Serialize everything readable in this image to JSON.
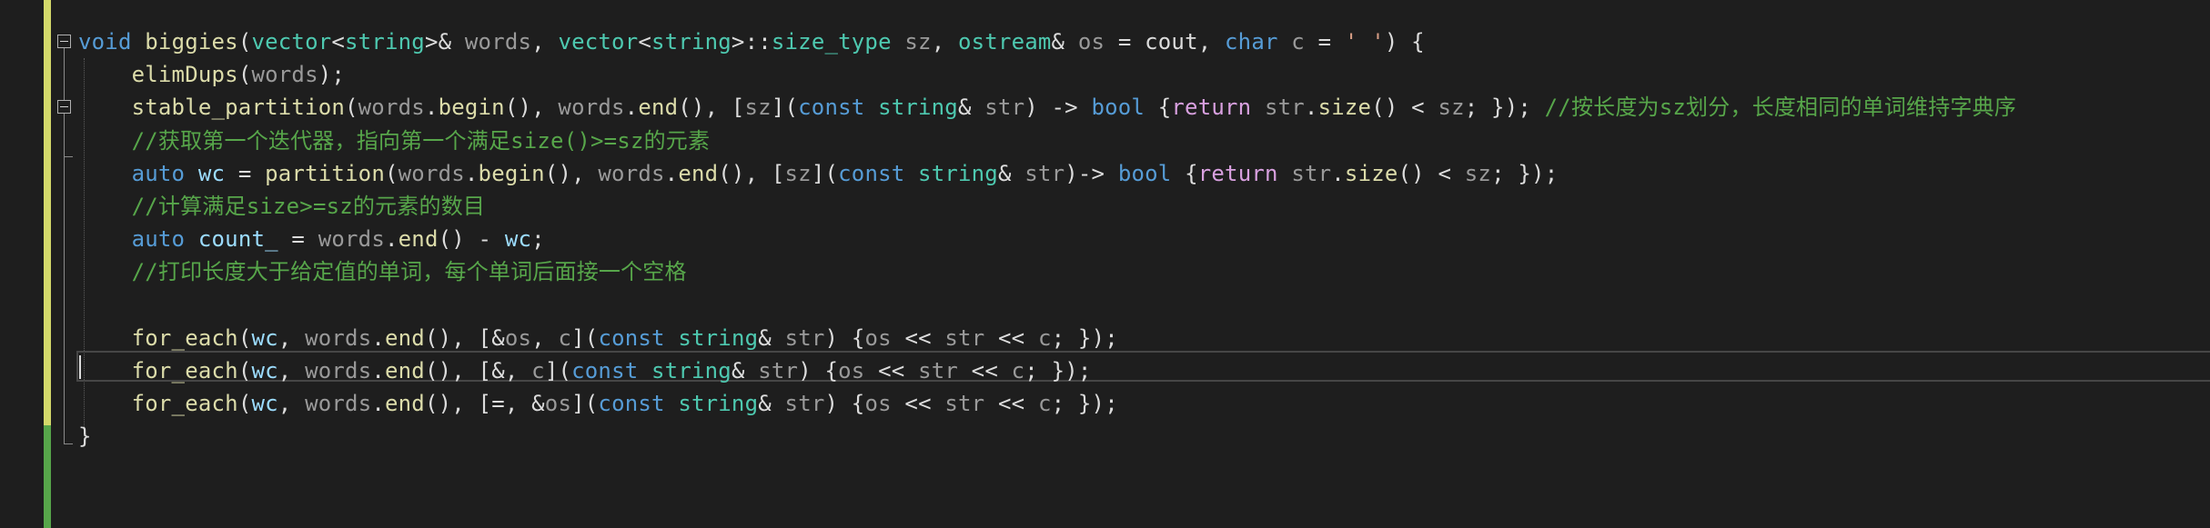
{
  "editor": {
    "lines": [
      [
        {
          "t": "void",
          "c": "kw"
        },
        {
          "t": " ",
          "c": "pl"
        },
        {
          "t": "biggies",
          "c": "fn"
        },
        {
          "t": "(",
          "c": "pl"
        },
        {
          "t": "vector",
          "c": "ty"
        },
        {
          "t": "<",
          "c": "pl"
        },
        {
          "t": "string",
          "c": "ty"
        },
        {
          "t": ">& ",
          "c": "pl"
        },
        {
          "t": "words",
          "c": "pm"
        },
        {
          "t": ", ",
          "c": "pl"
        },
        {
          "t": "vector",
          "c": "ty"
        },
        {
          "t": "<",
          "c": "pl"
        },
        {
          "t": "string",
          "c": "ty"
        },
        {
          "t": ">::",
          "c": "pl"
        },
        {
          "t": "size_type",
          "c": "ty"
        },
        {
          "t": " ",
          "c": "pl"
        },
        {
          "t": "sz",
          "c": "pm"
        },
        {
          "t": ", ",
          "c": "pl"
        },
        {
          "t": "ostream",
          "c": "ty"
        },
        {
          "t": "& ",
          "c": "pl"
        },
        {
          "t": "os",
          "c": "pm"
        },
        {
          "t": " = cout, ",
          "c": "pl"
        },
        {
          "t": "char",
          "c": "kw"
        },
        {
          "t": " ",
          "c": "pl"
        },
        {
          "t": "c",
          "c": "pm"
        },
        {
          "t": " = ",
          "c": "pl"
        },
        {
          "t": "' '",
          "c": "st"
        },
        {
          "t": ") {",
          "c": "pl"
        }
      ],
      [
        {
          "t": "    ",
          "c": "pl"
        },
        {
          "t": "elimDups",
          "c": "fn"
        },
        {
          "t": "(",
          "c": "pl"
        },
        {
          "t": "words",
          "c": "pm"
        },
        {
          "t": ");",
          "c": "pl"
        }
      ],
      [
        {
          "t": "    ",
          "c": "pl"
        },
        {
          "t": "stable_partition",
          "c": "fn"
        },
        {
          "t": "(",
          "c": "pl"
        },
        {
          "t": "words",
          "c": "pm"
        },
        {
          "t": ".",
          "c": "pl"
        },
        {
          "t": "begin",
          "c": "fn"
        },
        {
          "t": "(), ",
          "c": "pl"
        },
        {
          "t": "words",
          "c": "pm"
        },
        {
          "t": ".",
          "c": "pl"
        },
        {
          "t": "end",
          "c": "fn"
        },
        {
          "t": "(), [",
          "c": "pl"
        },
        {
          "t": "sz",
          "c": "pm"
        },
        {
          "t": "](",
          "c": "pl"
        },
        {
          "t": "const",
          "c": "kw"
        },
        {
          "t": " ",
          "c": "pl"
        },
        {
          "t": "string",
          "c": "ty"
        },
        {
          "t": "& ",
          "c": "pl"
        },
        {
          "t": "str",
          "c": "pm"
        },
        {
          "t": ") -> ",
          "c": "pl"
        },
        {
          "t": "bool",
          "c": "kw"
        },
        {
          "t": " {",
          "c": "pl"
        },
        {
          "t": "return",
          "c": "kw2"
        },
        {
          "t": " ",
          "c": "pl"
        },
        {
          "t": "str",
          "c": "pm"
        },
        {
          "t": ".",
          "c": "pl"
        },
        {
          "t": "size",
          "c": "fn"
        },
        {
          "t": "() < ",
          "c": "pl"
        },
        {
          "t": "sz",
          "c": "pm"
        },
        {
          "t": "; }); ",
          "c": "pl"
        },
        {
          "t": "//按长度为sz划分，长度相同的单词维持字典序",
          "c": "cm"
        }
      ],
      [
        {
          "t": "    ",
          "c": "pl"
        },
        {
          "t": "//获取第一个迭代器，指向第一个满足size()>=sz的元素",
          "c": "cm"
        }
      ],
      [
        {
          "t": "    ",
          "c": "pl"
        },
        {
          "t": "auto",
          "c": "kw"
        },
        {
          "t": " ",
          "c": "pl"
        },
        {
          "t": "wc",
          "c": "lv"
        },
        {
          "t": " = ",
          "c": "pl"
        },
        {
          "t": "partition",
          "c": "fn"
        },
        {
          "t": "(",
          "c": "pl"
        },
        {
          "t": "words",
          "c": "pm"
        },
        {
          "t": ".",
          "c": "pl"
        },
        {
          "t": "begin",
          "c": "fn"
        },
        {
          "t": "(), ",
          "c": "pl"
        },
        {
          "t": "words",
          "c": "pm"
        },
        {
          "t": ".",
          "c": "pl"
        },
        {
          "t": "end",
          "c": "fn"
        },
        {
          "t": "(), [",
          "c": "pl"
        },
        {
          "t": "sz",
          "c": "pm"
        },
        {
          "t": "](",
          "c": "pl"
        },
        {
          "t": "const",
          "c": "kw"
        },
        {
          "t": " ",
          "c": "pl"
        },
        {
          "t": "string",
          "c": "ty"
        },
        {
          "t": "& ",
          "c": "pl"
        },
        {
          "t": "str",
          "c": "pm"
        },
        {
          "t": ")-> ",
          "c": "pl"
        },
        {
          "t": "bool",
          "c": "kw"
        },
        {
          "t": " {",
          "c": "pl"
        },
        {
          "t": "return",
          "c": "kw2"
        },
        {
          "t": " ",
          "c": "pl"
        },
        {
          "t": "str",
          "c": "pm"
        },
        {
          "t": ".",
          "c": "pl"
        },
        {
          "t": "size",
          "c": "fn"
        },
        {
          "t": "() < ",
          "c": "pl"
        },
        {
          "t": "sz",
          "c": "pm"
        },
        {
          "t": "; });",
          "c": "pl"
        }
      ],
      [
        {
          "t": "    ",
          "c": "pl"
        },
        {
          "t": "//计算满足size>=sz的元素的数目",
          "c": "cm"
        }
      ],
      [
        {
          "t": "    ",
          "c": "pl"
        },
        {
          "t": "auto",
          "c": "kw"
        },
        {
          "t": " ",
          "c": "pl"
        },
        {
          "t": "count_",
          "c": "lv"
        },
        {
          "t": " = ",
          "c": "pl"
        },
        {
          "t": "words",
          "c": "pm"
        },
        {
          "t": ".",
          "c": "pl"
        },
        {
          "t": "end",
          "c": "fn"
        },
        {
          "t": "() - ",
          "c": "pl"
        },
        {
          "t": "wc",
          "c": "lv"
        },
        {
          "t": ";",
          "c": "pl"
        }
      ],
      [
        {
          "t": "    ",
          "c": "pl"
        },
        {
          "t": "//打印长度大于给定值的单词，每个单词后面接一个空格",
          "c": "cm"
        }
      ],
      [],
      [
        {
          "t": "    ",
          "c": "pl"
        },
        {
          "t": "for_each",
          "c": "fn"
        },
        {
          "t": "(",
          "c": "pl"
        },
        {
          "t": "wc",
          "c": "lv"
        },
        {
          "t": ", ",
          "c": "pl"
        },
        {
          "t": "words",
          "c": "pm"
        },
        {
          "t": ".",
          "c": "pl"
        },
        {
          "t": "end",
          "c": "fn"
        },
        {
          "t": "(), [&",
          "c": "pl"
        },
        {
          "t": "os",
          "c": "pm"
        },
        {
          "t": ", ",
          "c": "pl"
        },
        {
          "t": "c",
          "c": "pm"
        },
        {
          "t": "](",
          "c": "pl"
        },
        {
          "t": "const",
          "c": "kw"
        },
        {
          "t": " ",
          "c": "pl"
        },
        {
          "t": "string",
          "c": "ty"
        },
        {
          "t": "& ",
          "c": "pl"
        },
        {
          "t": "str",
          "c": "pm"
        },
        {
          "t": ") {",
          "c": "pl"
        },
        {
          "t": "os",
          "c": "pm"
        },
        {
          "t": " << ",
          "c": "pl"
        },
        {
          "t": "str",
          "c": "pm"
        },
        {
          "t": " << ",
          "c": "pl"
        },
        {
          "t": "c",
          "c": "pm"
        },
        {
          "t": "; });",
          "c": "pl"
        }
      ],
      [
        {
          "t": "    ",
          "c": "pl"
        },
        {
          "t": "for_each",
          "c": "fn"
        },
        {
          "t": "(",
          "c": "pl"
        },
        {
          "t": "wc",
          "c": "lv"
        },
        {
          "t": ", ",
          "c": "pl"
        },
        {
          "t": "words",
          "c": "pm"
        },
        {
          "t": ".",
          "c": "pl"
        },
        {
          "t": "end",
          "c": "fn"
        },
        {
          "t": "(), [&, ",
          "c": "pl"
        },
        {
          "t": "c",
          "c": "pm"
        },
        {
          "t": "](",
          "c": "pl"
        },
        {
          "t": "const",
          "c": "kw"
        },
        {
          "t": " ",
          "c": "pl"
        },
        {
          "t": "string",
          "c": "ty"
        },
        {
          "t": "& ",
          "c": "pl"
        },
        {
          "t": "str",
          "c": "pm"
        },
        {
          "t": ") {",
          "c": "pl"
        },
        {
          "t": "os",
          "c": "pm"
        },
        {
          "t": " << ",
          "c": "pl"
        },
        {
          "t": "str",
          "c": "pm"
        },
        {
          "t": " << ",
          "c": "pl"
        },
        {
          "t": "c",
          "c": "pm"
        },
        {
          "t": "; });",
          "c": "pl"
        }
      ],
      [
        {
          "t": "    ",
          "c": "pl"
        },
        {
          "t": "for_each",
          "c": "fn"
        },
        {
          "t": "(",
          "c": "pl"
        },
        {
          "t": "wc",
          "c": "lv"
        },
        {
          "t": ", ",
          "c": "pl"
        },
        {
          "t": "words",
          "c": "pm"
        },
        {
          "t": ".",
          "c": "pl"
        },
        {
          "t": "end",
          "c": "fn"
        },
        {
          "t": "(), [=, &",
          "c": "pl"
        },
        {
          "t": "os",
          "c": "pm"
        },
        {
          "t": "](",
          "c": "pl"
        },
        {
          "t": "const",
          "c": "kw"
        },
        {
          "t": " ",
          "c": "pl"
        },
        {
          "t": "string",
          "c": "ty"
        },
        {
          "t": "& ",
          "c": "pl"
        },
        {
          "t": "str",
          "c": "pm"
        },
        {
          "t": ") {",
          "c": "pl"
        },
        {
          "t": "os",
          "c": "pm"
        },
        {
          "t": " << ",
          "c": "pl"
        },
        {
          "t": "str",
          "c": "pm"
        },
        {
          "t": " << ",
          "c": "pl"
        },
        {
          "t": "c",
          "c": "pm"
        },
        {
          "t": "; });",
          "c": "pl"
        }
      ],
      [
        {
          "t": "}",
          "c": "pl"
        }
      ]
    ],
    "current_line": 10,
    "collapsible_lines": [
      0,
      2
    ],
    "colors": {
      "background": "#1e1e1e",
      "keyword": "#569cd6",
      "control_keyword": "#d8a0df",
      "type": "#4ec9b0",
      "function": "#dcdcaa",
      "parameter": "#9a9a9a",
      "local": "#9cdcfe",
      "comment": "#57a64a",
      "string": "#d69d85",
      "plain": "#dcdcdc",
      "unsaved_change_bar": "#d4d96a",
      "saved_change_bar": "#57a64a"
    }
  }
}
